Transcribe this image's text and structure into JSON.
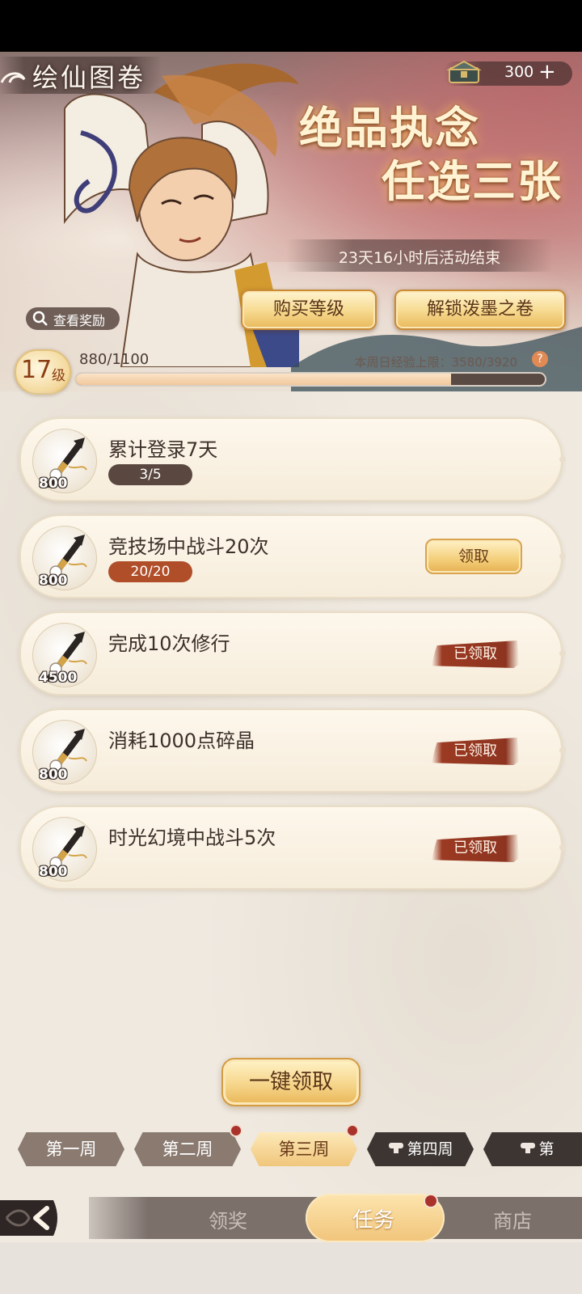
{
  "header": {
    "title": "绘仙图卷",
    "currency_value": "300",
    "currency_plus": "+",
    "slogan_line1": "绝品执念",
    "slogan_line2": "任选三张",
    "timer": "23天16小时后活动结束",
    "buy_level_label": "购买等级",
    "unlock_label": "解锁泼墨之卷",
    "view_reward_label": "查看奖励"
  },
  "level": {
    "number": "17",
    "unit": "级",
    "xp_text": "880/1100",
    "xp_fraction": 0.8,
    "weekly_cap": "本周日经验上限：3580/3920",
    "help_glyph": "?"
  },
  "tasks": [
    {
      "title": "累计登录7天",
      "reward": "800",
      "progress": "3/5",
      "status": "in_progress"
    },
    {
      "title": "竞技场中战斗20次",
      "reward": "800",
      "progress": "20/20",
      "status": "claimable",
      "action_label": "领取"
    },
    {
      "title": "完成10次修行",
      "reward": "4500",
      "status": "claimed",
      "action_label": "已领取"
    },
    {
      "title": "消耗1000点碎晶",
      "reward": "800",
      "status": "claimed",
      "action_label": "已领取"
    },
    {
      "title": "时光幻境中战斗5次",
      "reward": "800",
      "status": "claimed",
      "action_label": "已领取"
    }
  ],
  "claim_all_label": "一键领取",
  "weeks": [
    {
      "label": "第一周",
      "state": "normal",
      "badge": false
    },
    {
      "label": "第二周",
      "state": "normal",
      "badge": true
    },
    {
      "label": "第三周",
      "state": "active",
      "badge": true
    },
    {
      "label": "第四周",
      "state": "locked",
      "badge": false
    },
    {
      "label": "第",
      "state": "locked",
      "badge": false
    }
  ],
  "bottom_nav": {
    "tab1": "领奖",
    "tab2": "任务",
    "tab3": "商店",
    "active": "任务"
  },
  "colors": {
    "accent_gold": "#f4cf7a",
    "claimed_red": "#9b3a22",
    "progress_done": "#b04e2a",
    "badge_red": "#a9332b"
  }
}
